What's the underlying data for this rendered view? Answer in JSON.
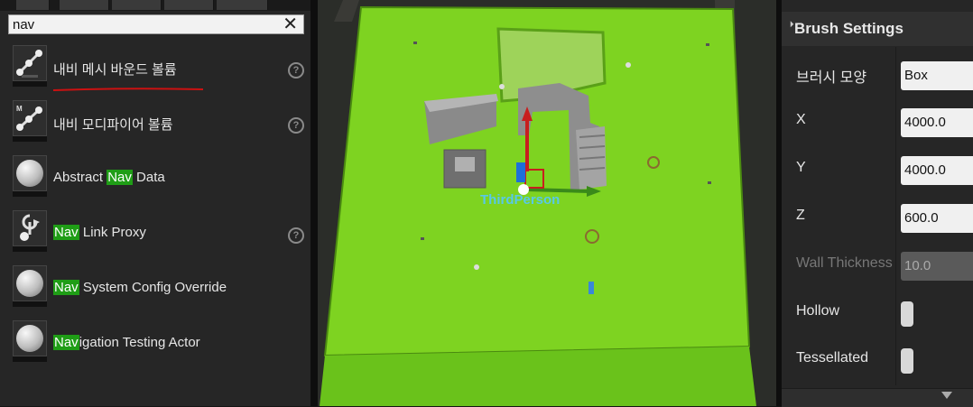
{
  "search": {
    "value": "nav",
    "clear_icon": "close-icon"
  },
  "actors": [
    {
      "label": "내비 메시 바운드 볼륨",
      "prefix": "",
      "match": "",
      "suffix": "",
      "icon": "navmesh-bounds-icon",
      "help": true
    },
    {
      "label": "내비 모디파이어 볼륨",
      "prefix": "",
      "match": "",
      "suffix": "",
      "icon": "nav-modifier-icon",
      "help": true
    },
    {
      "label": "",
      "prefix": "Abstract ",
      "match": "Nav",
      "suffix": " Data",
      "icon": "sphere-icon",
      "help": false
    },
    {
      "label": "",
      "prefix": "",
      "match": "Nav",
      "suffix": " Link Proxy",
      "icon": "nav-link-proxy-icon",
      "help": true
    },
    {
      "label": "",
      "prefix": "",
      "match": "Nav",
      "suffix": " System Config Override",
      "icon": "sphere-icon",
      "help": false
    },
    {
      "label": "",
      "prefix": "",
      "match": "Nav",
      "suffix": "igation Testing Actor",
      "icon": "sphere-icon",
      "help": false
    }
  ],
  "viewport": {
    "player_label": "ThirdPerson"
  },
  "brush": {
    "title": "Brush Settings",
    "shape_label": "브러시 모양",
    "shape_value": "Box",
    "x_label": "X",
    "x_value": "4000.0",
    "y_label": "Y",
    "y_value": "4000.0",
    "z_label": "Z",
    "z_value": "600.0",
    "wall_label": "Wall Thickness",
    "wall_value": "10.0",
    "hollow_label": "Hollow",
    "tess_label": "Tessellated"
  },
  "colors": {
    "highlight": "#1f9d16",
    "navmesh": "#7ed321",
    "annotation": "#cc1111"
  }
}
